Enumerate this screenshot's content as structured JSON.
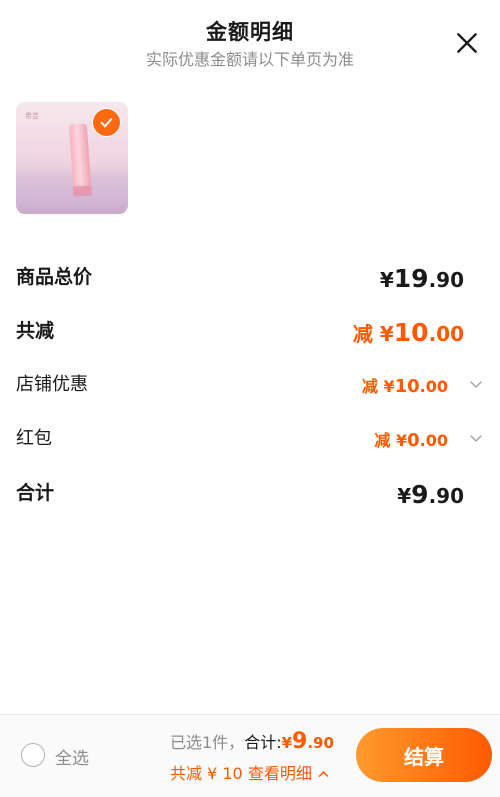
{
  "header": {
    "title": "金额明细",
    "subtitle": "实际优惠金额请以下单页为准"
  },
  "product": {
    "brand_text": "希芸",
    "selected": true
  },
  "rows": {
    "goods_total": {
      "label": "商品总价",
      "currency": "¥",
      "integer": "19",
      "decimal": ".90"
    },
    "total_reduction": {
      "label": "共减",
      "prefix": "减 ",
      "currency": "¥",
      "integer": "10",
      "decimal": ".00"
    },
    "shop_discount": {
      "label": "店铺优惠",
      "prefix": "减 ",
      "currency": "¥",
      "integer": "10",
      "decimal": ".00"
    },
    "red_packet": {
      "label": "红包",
      "prefix": "减 ",
      "currency": "¥",
      "integer": "0",
      "decimal": ".00"
    },
    "grand_total": {
      "label": "合计",
      "currency": "¥",
      "integer": "9",
      "decimal": ".90"
    }
  },
  "footer": {
    "select_all_label": "全选",
    "selected_text": "已选1件，",
    "total_label": "合计:",
    "total_currency": "¥",
    "total_integer": "9",
    "total_decimal": ".90",
    "discount_text": "共减 ¥ 10",
    "view_detail_label": "查看明细",
    "checkout_label": "结算"
  },
  "colors": {
    "accent": "#ff5a00",
    "muted": "#8c8c8c"
  },
  "icons": {
    "close": "close-icon",
    "check": "check-icon",
    "chevron": "chevron-down-icon",
    "chevron_up": "chevron-up-icon"
  }
}
